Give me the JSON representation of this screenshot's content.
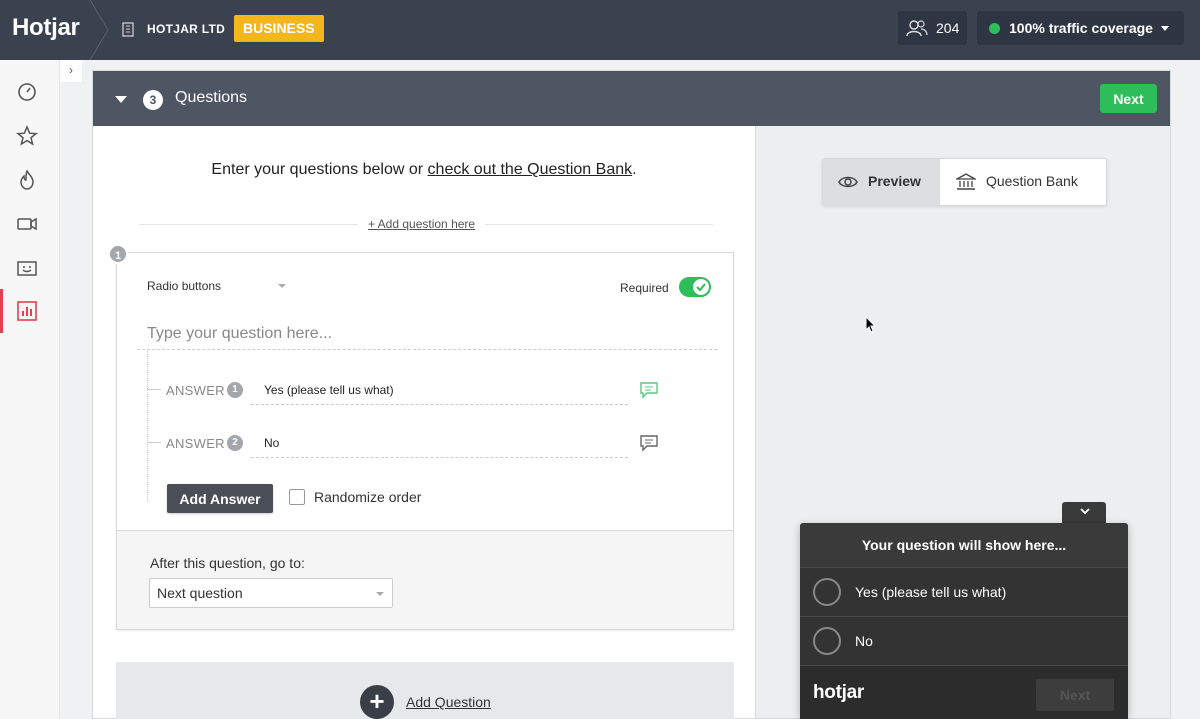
{
  "topbar": {
    "logo": "Hotjar",
    "org_name": "HOTJAR LTD",
    "plan_badge": "BUSINESS",
    "users_count": "204",
    "traffic_label": "100% traffic coverage",
    "icons": [
      "building-icon",
      "users-icon",
      "status-dot-icon",
      "caret-down-icon"
    ]
  },
  "sidebar": {
    "items": [
      {
        "name": "dashboard",
        "icon": "gauge-icon"
      },
      {
        "name": "favorites",
        "icon": "star-icon"
      },
      {
        "name": "heatmaps",
        "icon": "flame-icon"
      },
      {
        "name": "recordings",
        "icon": "video-camera-icon"
      },
      {
        "name": "feedback",
        "icon": "smiley-box-icon"
      },
      {
        "name": "surveys",
        "icon": "bar-chart-icon",
        "active": true
      }
    ],
    "collapse_icon": "chevron-right-icon"
  },
  "step": {
    "number": "3",
    "title": "Questions",
    "next_label": "Next"
  },
  "editor": {
    "intro_text": "Enter your questions below or ",
    "intro_link": "check out the Question Bank",
    "intro_end": ".",
    "add_question_here": "+ Add question here",
    "question": {
      "number": "1",
      "type": "Radio buttons",
      "required_label": "Required",
      "required": true,
      "placeholder": "Type your question here...",
      "answer_label": "ANSWER",
      "answers": [
        {
          "number": "1",
          "value": "Yes (please tell us what)",
          "comment_active": true
        },
        {
          "number": "2",
          "value": "No",
          "comment_active": false
        }
      ],
      "add_answer_label": "Add Answer",
      "randomize_label": "Randomize order",
      "after_label": "After this question, go to:",
      "after_value": "Next question"
    },
    "add_question_label": "Add Question"
  },
  "preview": {
    "preview_tab": "Preview",
    "bank_tab": "Question Bank",
    "widget": {
      "title": "Your question will show here...",
      "options": [
        "Yes (please tell us what)",
        "No"
      ],
      "logo": "hotjar",
      "next_label": "Next"
    }
  },
  "colors": {
    "topbar": "#3a4250",
    "badge": "#f4b61b",
    "green": "#2ebd58",
    "active_nav": "#e63e4f"
  }
}
